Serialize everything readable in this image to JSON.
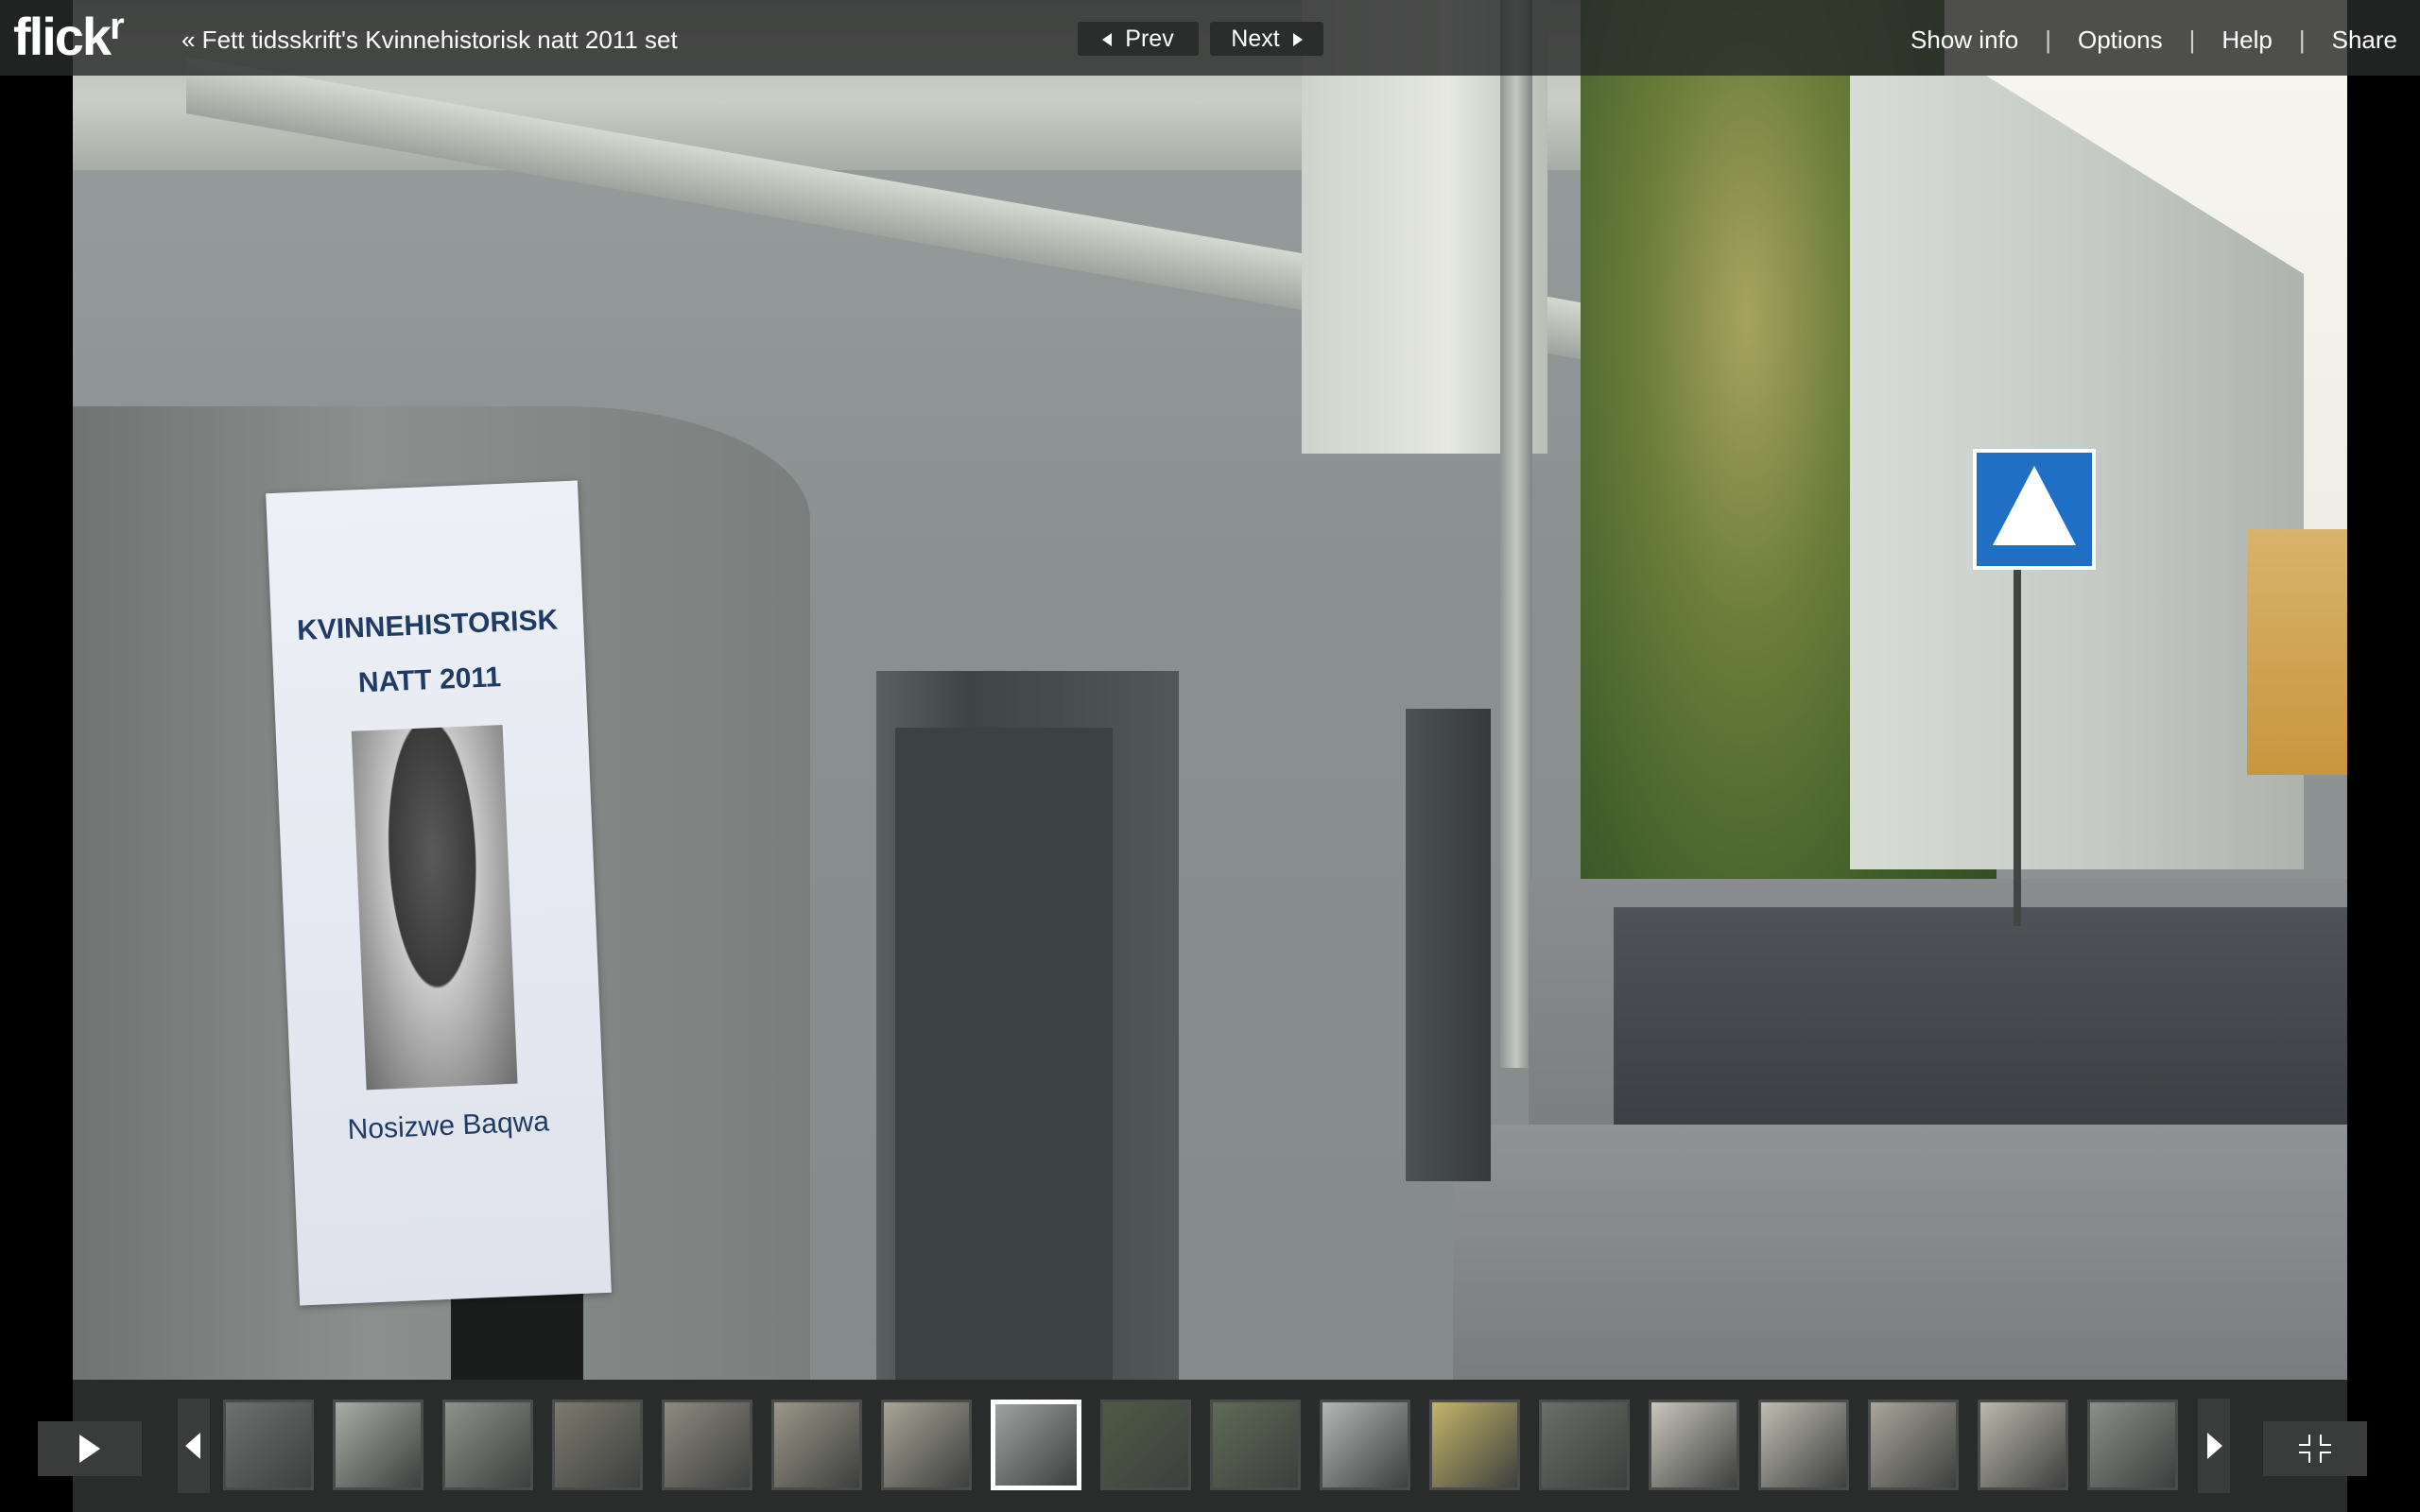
{
  "app": {
    "logo_text": "flick",
    "logo_r": "r",
    "set_link": "« Fett tidsskrift's Kvinnehistorisk natt 2011 set"
  },
  "nav": {
    "prev_label": "Prev",
    "next_label": "Next"
  },
  "menu": {
    "items": [
      "Show info",
      "Options",
      "Help",
      "Share"
    ],
    "separator": "|"
  },
  "photo": {
    "poster_line1": "KVINNEHISTORISK",
    "poster_line2": "NATT 2011",
    "poster_name": "Nosizwe Baqwa"
  },
  "filmstrip": {
    "active_index": 7,
    "thumbnails": [
      {
        "icon": "thumbnail-image",
        "color": "#6e7170"
      },
      {
        "icon": "thumbnail-image",
        "color": "#a9aca5"
      },
      {
        "icon": "thumbnail-image",
        "color": "#8f918c"
      },
      {
        "icon": "thumbnail-image",
        "color": "#7c7a6e"
      },
      {
        "icon": "thumbnail-image",
        "color": "#8e8a80"
      },
      {
        "icon": "thumbnail-image",
        "color": "#9b9688"
      },
      {
        "icon": "thumbnail-image",
        "color": "#a8a496"
      },
      {
        "icon": "thumbnail-image",
        "color": "#9ea2a0"
      },
      {
        "icon": "thumbnail-image",
        "color": "#4e5a44"
      },
      {
        "icon": "thumbnail-image",
        "color": "#5f6a55"
      },
      {
        "icon": "thumbnail-image",
        "color": "#b3b6b4"
      },
      {
        "icon": "thumbnail-image",
        "color": "#c3b46a"
      },
      {
        "icon": "thumbnail-image",
        "color": "#6b6d67"
      },
      {
        "icon": "thumbnail-image",
        "color": "#c8c6bc"
      },
      {
        "icon": "thumbnail-image",
        "color": "#bfbdb2"
      },
      {
        "icon": "thumbnail-image",
        "color": "#a9a59a"
      },
      {
        "icon": "thumbnail-image",
        "color": "#bcb8ad"
      },
      {
        "icon": "thumbnail-image",
        "color": "#8c8e8b"
      }
    ]
  }
}
